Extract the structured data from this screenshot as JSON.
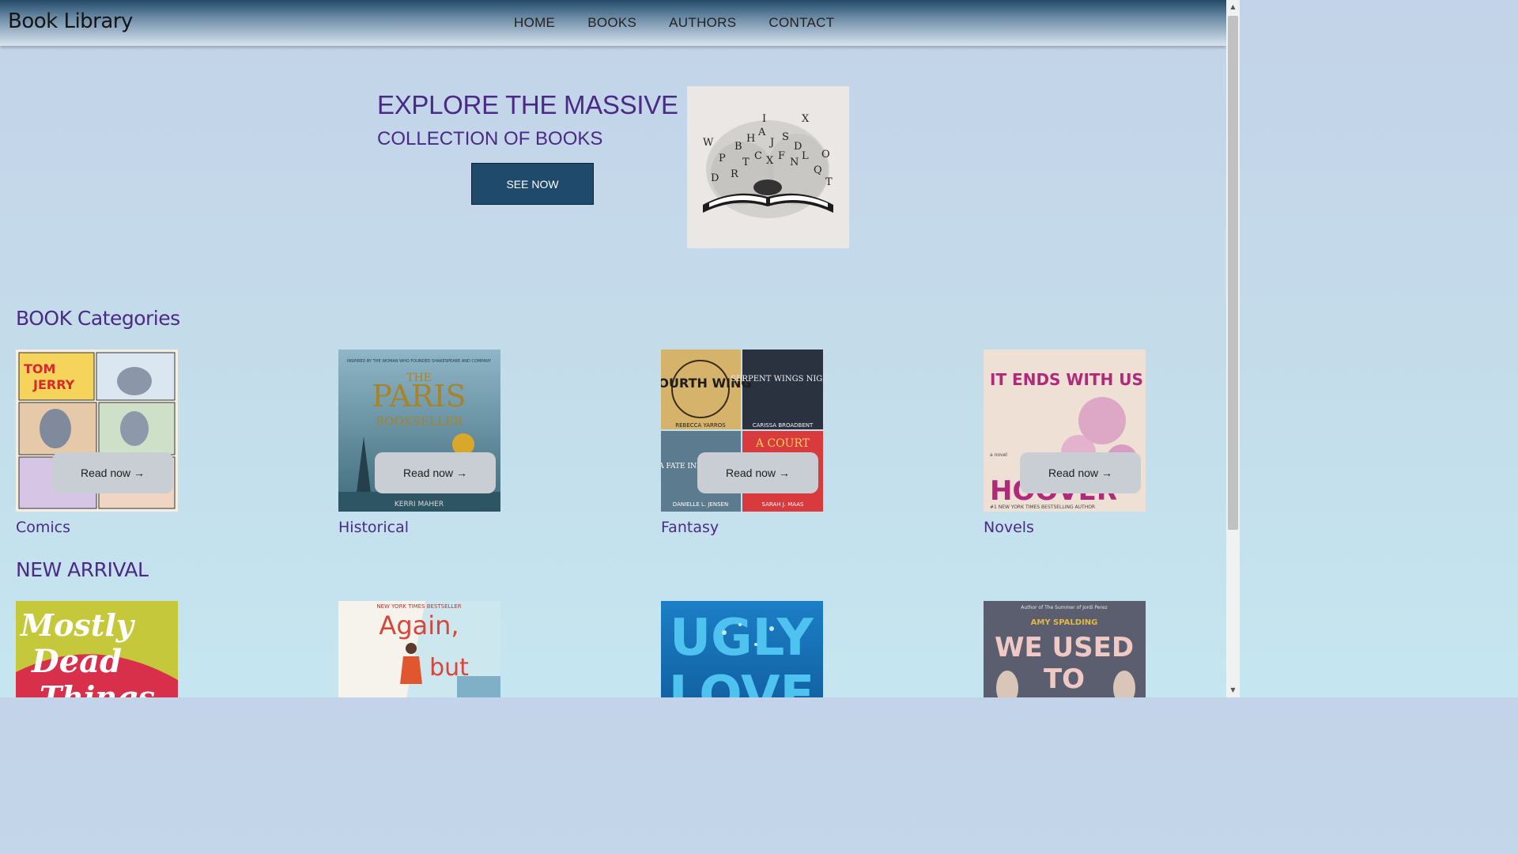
{
  "header": {
    "brand": "Book Library",
    "nav": [
      "HOME",
      "BOOKS",
      "AUTHORS",
      "CONTACT"
    ]
  },
  "hero": {
    "title_line1": "EXPLORE THE MASSIVE",
    "title_line2": "COLLECTION OF BOOKS",
    "button_label": "SEE NOW"
  },
  "categories": {
    "title": "BOOK Categories",
    "read_label": "Read now",
    "items": [
      {
        "label": "Comics",
        "cover_text": [
          "TOM",
          "JERRY"
        ]
      },
      {
        "label": "Historical",
        "cover_text": [
          "INSPIRED BY THE WOMAN WHO FOUNDED SHAKESPEARE AND COMPANY",
          "THE",
          "PARIS",
          "BOOKSELLER",
          "KERRI MAHER"
        ]
      },
      {
        "label": "Fantasy",
        "cover_text": [
          "FOURTH WING",
          "REBECCA YARROS",
          "SERPENT WINGS NIGHT",
          "CARISSA BROADBENT",
          "A FATE INKED BLOOD",
          "DANIELLE L. JENSEN",
          "A COURT",
          "SARAH J. MAAS"
        ]
      },
      {
        "label": "Novels",
        "cover_text": [
          "IT ENDS WITH US",
          "HOOVER",
          "a novel",
          "#1 NEW YORK TIMES BESTSELLING AUTHOR"
        ]
      }
    ]
  },
  "new_arrival": {
    "title": "NEW ARRIVAL",
    "items": [
      {
        "cover_text": [
          "Mostly",
          "Dead",
          "Things"
        ]
      },
      {
        "cover_text": [
          "NEW YORK TIMES BESTSELLER",
          "Again,",
          "but"
        ]
      },
      {
        "cover_text": [
          "UGLY",
          "LOVE"
        ]
      },
      {
        "cover_text": [
          "Author of The Summer of Jordi Perez",
          "AMY SPALDING",
          "WE USED",
          "TO"
        ]
      }
    ]
  },
  "colors": {
    "accent": "#4a2a86",
    "button_bg": "#1f4a6b"
  }
}
